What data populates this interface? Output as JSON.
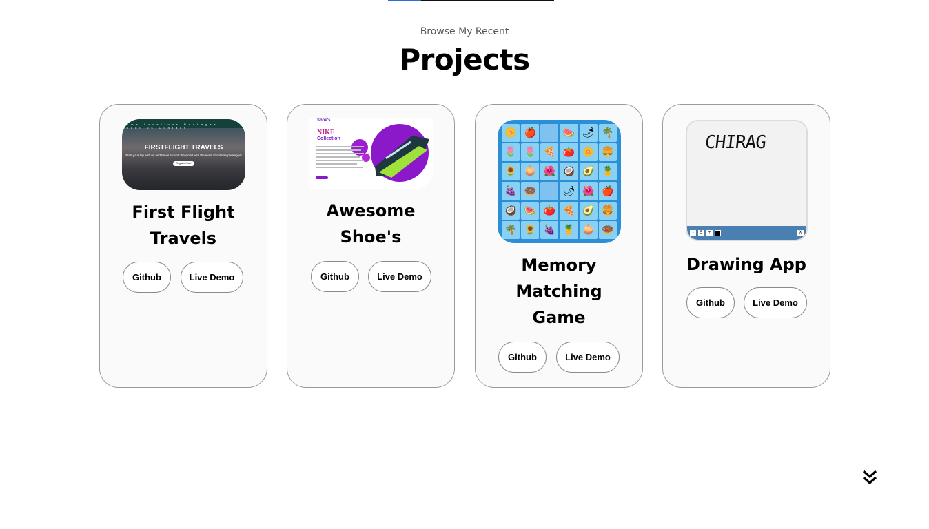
{
  "header": {
    "subtitle": "Browse My Recent",
    "title": "Projects"
  },
  "projects": [
    {
      "name_line1": "First Flight",
      "name_line2": "Travels",
      "github_label": "Github",
      "demo_label": "Live Demo",
      "thumb": {
        "headline": "FIRSTFLIGHT TRAVELS",
        "tagline": "Plan your trip with us and travel around the world with the most affordable packages!",
        "cta": "Register Now!",
        "nav": "Home Locations Packages About Us Contact"
      }
    },
    {
      "name_line1": "Awesome",
      "name_line2": "Shoe's",
      "github_label": "Github",
      "demo_label": "Live Demo",
      "thumb": {
        "brand": "Shoe's",
        "heading1": "NIKE",
        "heading2": "Collection"
      }
    },
    {
      "name_line1": "Memory",
      "name_line2": "Matching",
      "name_line3": "Game",
      "github_label": "Github",
      "demo_label": "Live Demo"
    },
    {
      "name_line1": "Drawing App",
      "github_label": "Github",
      "demo_label": "Live Demo",
      "thumb": {
        "sketch_text": "CHIRAG",
        "size_value": "5",
        "minus": "-",
        "plus": "+",
        "clear": "X"
      }
    }
  ],
  "memory_grid": [
    "🌼",
    "🍎",
    "",
    "🍉",
    "🌶",
    "🌴",
    "🌷",
    "🌷",
    "🍕",
    "🍅",
    "🌼",
    "🍔",
    "🌻",
    "🧅",
    "🌺",
    "🥥",
    "🥑",
    "🍍",
    "🍇",
    "🍩",
    "",
    "🌶",
    "🌺",
    "🍎",
    "🥥",
    "🍉",
    "🍅",
    "🍕",
    "🥑",
    "🍔",
    "🌴",
    "🌻",
    "🍇",
    "🍍",
    "🧅",
    "🍩"
  ],
  "colors": {
    "accent": "#2a6fd6",
    "card_border": "#9a9a9a",
    "card_bg": "#fafafa"
  },
  "scroll_progress": 0.2,
  "scroll_icon": "double-chevron-down-icon"
}
